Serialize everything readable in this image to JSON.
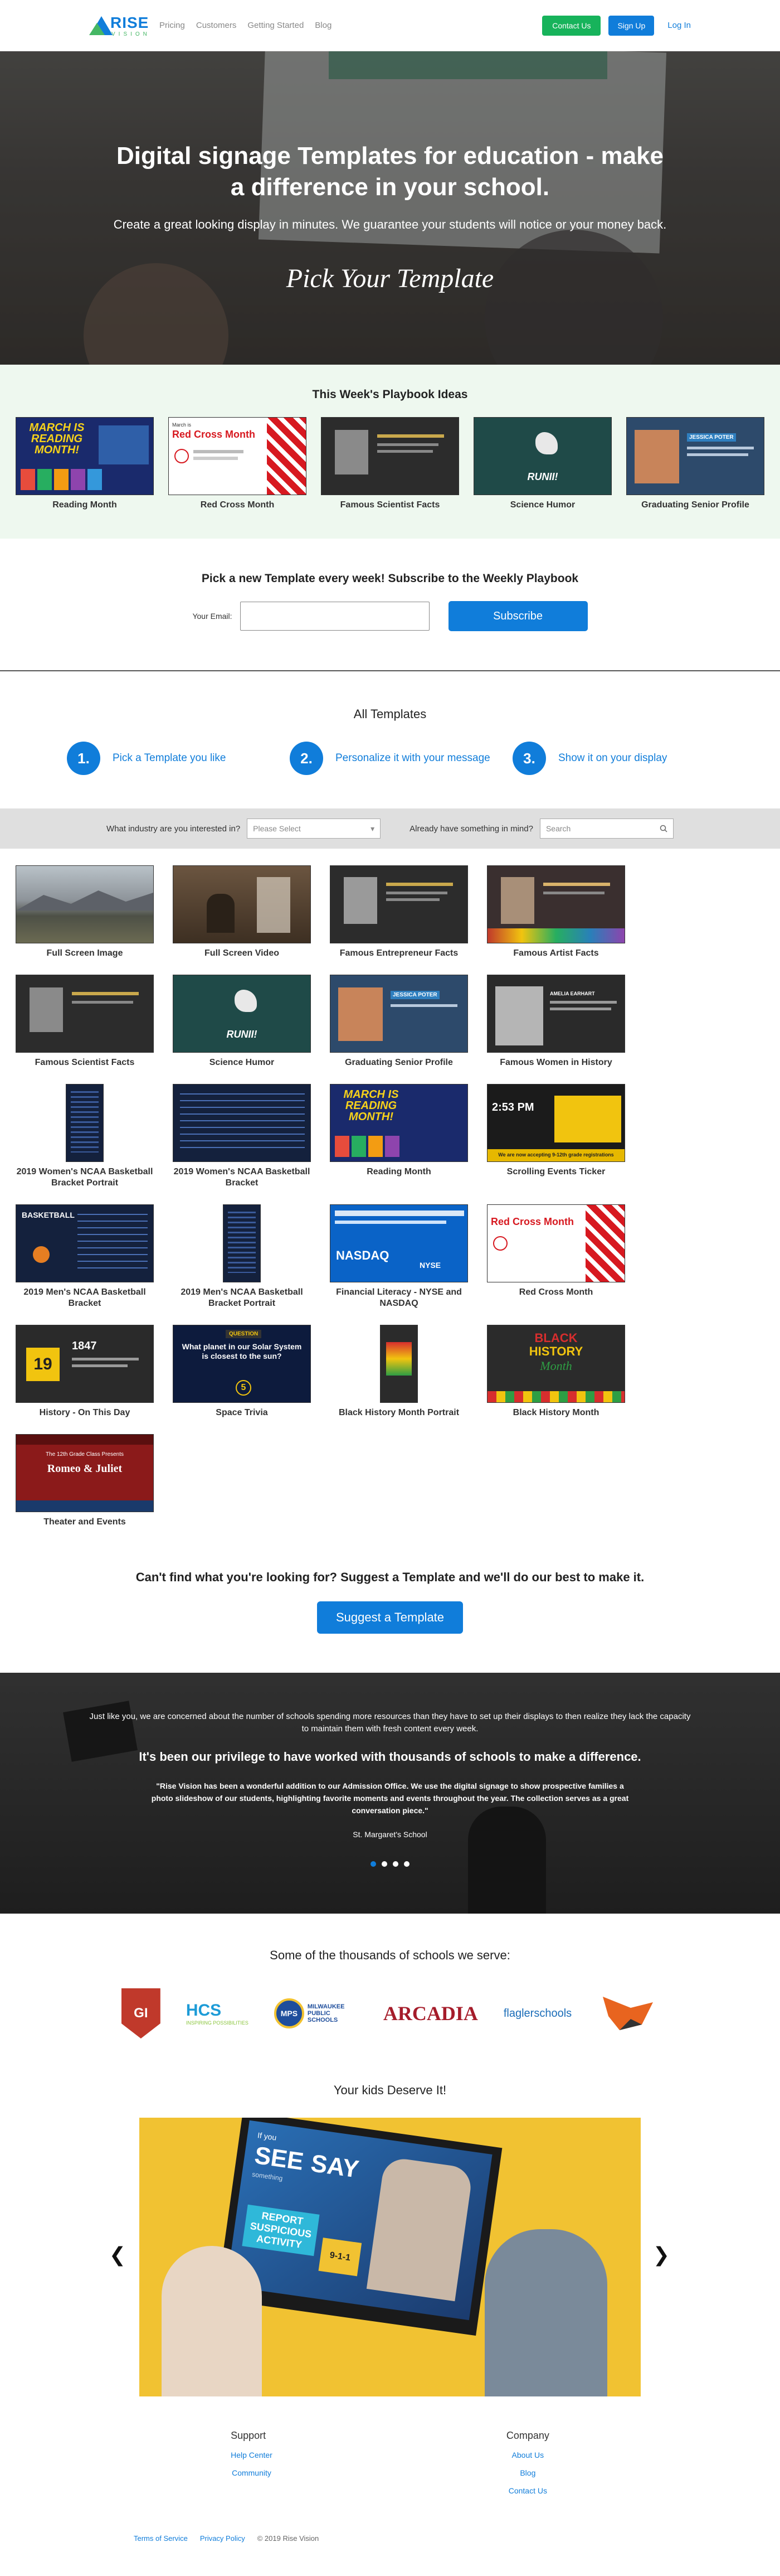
{
  "nav": {
    "brand": "RISE",
    "brand_sub": "VISION",
    "links": [
      "Pricing",
      "Customers",
      "Getting Started",
      "Blog"
    ],
    "contact": "Contact Us",
    "signup": "Sign Up",
    "login": "Log In"
  },
  "hero": {
    "title": "Digital signage Templates for education - make a difference in your school.",
    "subtitle": "Create a great looking display in minutes. We guarantee your students will notice or your money back.",
    "cta": "Pick Your Template"
  },
  "playbook": {
    "heading": "This Week's Playbook Ideas",
    "items": [
      {
        "label": "Reading Month"
      },
      {
        "label": "Red Cross Month"
      },
      {
        "label": "Famous Scientist Facts"
      },
      {
        "label": "Science Humor"
      },
      {
        "label": "Graduating Senior Profile"
      }
    ]
  },
  "subscribe": {
    "heading": "Pick a new Template every week! Subscribe to the Weekly Playbook",
    "email_label": "Your Email:",
    "button": "Subscribe"
  },
  "steps": {
    "heading": "All Templates",
    "items": [
      {
        "num": "1.",
        "text": "Pick a Template you like"
      },
      {
        "num": "2.",
        "text": "Personalize it with your message"
      },
      {
        "num": "3.",
        "text": "Show it on your display"
      }
    ]
  },
  "filter": {
    "industry_label": "What industry are you interested in?",
    "industry_value": "Please Select",
    "search_label": "Already have something in mind?",
    "search_placeholder": "Search"
  },
  "templates": [
    {
      "label": "Full Screen Image"
    },
    {
      "label": "Full Screen Video"
    },
    {
      "label": "Famous Entrepreneur Facts"
    },
    {
      "label": "Famous Artist Facts"
    },
    {
      "label": "Famous Scientist Facts"
    },
    {
      "label": "Science Humor"
    },
    {
      "label": "Graduating Senior Profile"
    },
    {
      "label": "Famous Women in History"
    },
    {
      "label": "2019 Women's NCAA Basketball Bracket Portrait"
    },
    {
      "label": "2019 Women's NCAA Basketball Bracket"
    },
    {
      "label": "Reading Month"
    },
    {
      "label": "Scrolling Events Ticker"
    },
    {
      "label": "2019 Men's NCAA Basketball Bracket"
    },
    {
      "label": "2019 Men's NCAA Basketball Bracket Portrait"
    },
    {
      "label": "Financial Literacy - NYSE and NASDAQ"
    },
    {
      "label": "Red Cross Month"
    },
    {
      "label": "History - On This Day"
    },
    {
      "label": "Space Trivia"
    },
    {
      "label": "Black History Month Portrait"
    },
    {
      "label": "Black History Month"
    },
    {
      "label": "Theater and Events"
    }
  ],
  "thumb_text": {
    "reading": "MARCH IS READING MONTH!",
    "redcross": "Red Cross Month",
    "redcross_small": "March is",
    "runii": "RUNII!",
    "jessica": "JESSICA POTER",
    "nasdaq": "NASDAQ",
    "nyse": "NYSE",
    "question": "What planet in our Solar System is closest to the sun?",
    "question_tag": "QUESTION",
    "num5": "5",
    "time": "2:53 PM",
    "ticker": "We are now accepting 9-12th grade registrations",
    "day": "19",
    "year": "1847",
    "black": "BLACK",
    "history": "HISTORY",
    "month": "Month",
    "romeo": "Romeo & Juliet",
    "theater_top": "The 12th Grade Class Presents",
    "bball": "BASKETBALL",
    "amelia": "AMELIA EARHART"
  },
  "suggest": {
    "heading": "Can't find what you're looking for? Suggest a Template and we'll do our best to make it.",
    "button": "Suggest a Template"
  },
  "testimonial": {
    "intro": "Just like you, we are concerned about the number of schools spending more resources than they have to set up their displays to then realize they lack the capacity to maintain them with fresh content every week.",
    "heading": "It's been our privilege to have worked with thousands of schools to make a difference.",
    "quote": "\"Rise Vision has been a wonderful addition to our Admission Office. We use the digital signage to show prospective families a photo slideshow of our students, highlighting favorite moments and events throughout the year. The collection serves as a great conversation piece.\"",
    "who": "St. Margaret's School"
  },
  "schools": {
    "heading": "Some of the thousands of schools we serve:",
    "logos": [
      "GI",
      "HCS",
      "INSPIRING POSSIBILITIES",
      "MPS",
      "MILWAUKEE PUBLIC SCHOOLS",
      "ARCADIA",
      "flaglerschools"
    ]
  },
  "kids": {
    "heading": "Your kids Deserve It!",
    "sign1": "If you",
    "sign2": "SEE",
    "sign3": "SAY",
    "sign4": "something",
    "sign5": "REPORT SUSPICIOUS ACTIVITY",
    "sign6": "9-1-1"
  },
  "footer": {
    "support_h": "Support",
    "support": [
      "Help Center",
      "Community"
    ],
    "company_h": "Company",
    "company": [
      "About Us",
      "Blog",
      "Contact Us"
    ],
    "bottom": [
      "Terms of Service",
      "Privacy Policy"
    ],
    "copyright": "© 2019 Rise Vision"
  },
  "colors": {
    "accent": "#107dda",
    "green": "#17b35b",
    "playbook_bg": "#eef8ef"
  }
}
